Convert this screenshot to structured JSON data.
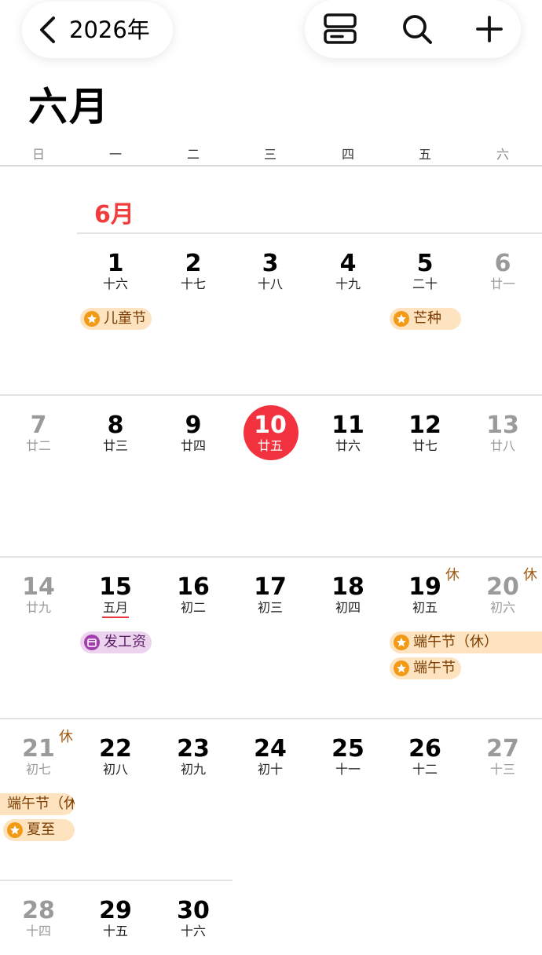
{
  "header": {
    "year_label": "2026年",
    "month_title": "六月"
  },
  "weekdays": [
    "日",
    "一",
    "二",
    "三",
    "四",
    "五",
    "六"
  ],
  "month_label": "6月",
  "rest_mark": "休",
  "days": {
    "d1": {
      "num": "1",
      "lunar": "十六"
    },
    "d2": {
      "num": "2",
      "lunar": "十七"
    },
    "d3": {
      "num": "3",
      "lunar": "十八"
    },
    "d4": {
      "num": "4",
      "lunar": "十九"
    },
    "d5": {
      "num": "5",
      "lunar": "二十"
    },
    "d6": {
      "num": "6",
      "lunar": "廿一"
    },
    "d7": {
      "num": "7",
      "lunar": "廿二"
    },
    "d8": {
      "num": "8",
      "lunar": "廿三"
    },
    "d9": {
      "num": "9",
      "lunar": "廿四"
    },
    "d10": {
      "num": "10",
      "lunar": "廿五"
    },
    "d11": {
      "num": "11",
      "lunar": "廿六"
    },
    "d12": {
      "num": "12",
      "lunar": "廿七"
    },
    "d13": {
      "num": "13",
      "lunar": "廿八"
    },
    "d14": {
      "num": "14",
      "lunar": "廿九"
    },
    "d15": {
      "num": "15",
      "lunar": "五月"
    },
    "d16": {
      "num": "16",
      "lunar": "初二"
    },
    "d17": {
      "num": "17",
      "lunar": "初三"
    },
    "d18": {
      "num": "18",
      "lunar": "初四"
    },
    "d19": {
      "num": "19",
      "lunar": "初五"
    },
    "d20": {
      "num": "20",
      "lunar": "初六"
    },
    "d21": {
      "num": "21",
      "lunar": "初七"
    },
    "d22": {
      "num": "22",
      "lunar": "初八"
    },
    "d23": {
      "num": "23",
      "lunar": "初九"
    },
    "d24": {
      "num": "24",
      "lunar": "初十"
    },
    "d25": {
      "num": "25",
      "lunar": "十一"
    },
    "d26": {
      "num": "26",
      "lunar": "十二"
    },
    "d27": {
      "num": "27",
      "lunar": "十三"
    },
    "d28": {
      "num": "28",
      "lunar": "十四"
    },
    "d29": {
      "num": "29",
      "lunar": "十五"
    },
    "d30": {
      "num": "30",
      "lunar": "十六"
    }
  },
  "events": {
    "childrens_day": "儿童节",
    "mangzhong": "芒种",
    "payday": "发工资",
    "dragon_boat_holiday": "端午节（休）",
    "dragon_boat": "端午节",
    "dragon_boat_holiday_cont": "端午节（休",
    "summer_solstice": "夏至"
  },
  "colors": {
    "today": "#f2333f",
    "accent_red": "#f03c3c",
    "holiday_bg": "#fde3c0",
    "holiday_icon": "#f29a15",
    "payday_bg": "#ecd3ee",
    "payday_icon": "#a23fae"
  },
  "icons": {
    "back": "chevron-left-icon",
    "view": "list-view-icon",
    "search": "search-icon",
    "add": "plus-icon"
  }
}
